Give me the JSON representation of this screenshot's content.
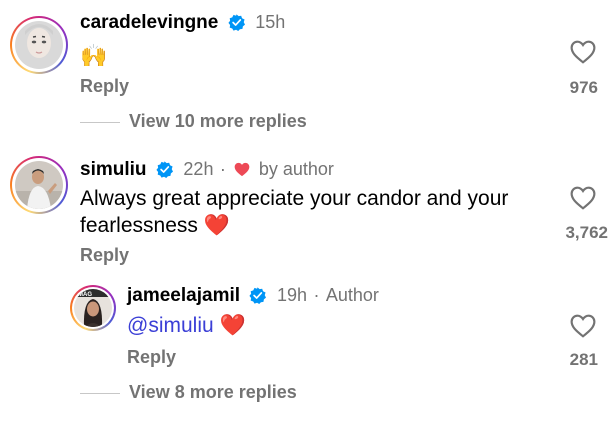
{
  "comments": [
    {
      "username": "caradelevingne",
      "time": "15h",
      "text": "🙌",
      "reply_label": "Reply",
      "likes": "976",
      "view_more": "View 10 more replies"
    },
    {
      "username": "simuliu",
      "time": "22h",
      "separator": "·",
      "by_author": "by author",
      "text": "Always great appreciate your candor and your fearlessness",
      "emoji": "❤️",
      "reply_label": "Reply",
      "likes": "3,762"
    }
  ],
  "reply": {
    "username": "jameelajamil",
    "time": "19h",
    "separator": "·",
    "badge": "Author",
    "mention": "@simuliu",
    "emoji": "❤️",
    "reply_label": "Reply",
    "likes": "281",
    "view_more": "View 8 more replies"
  },
  "colors": {
    "verified": "#0095f6",
    "liked_heart": "#ed4956",
    "muted": "#737373",
    "mention": "#3b3fd6"
  },
  "icons": [
    "verified-badge-icon",
    "heart-outline-icon",
    "small-heart-icon"
  ]
}
